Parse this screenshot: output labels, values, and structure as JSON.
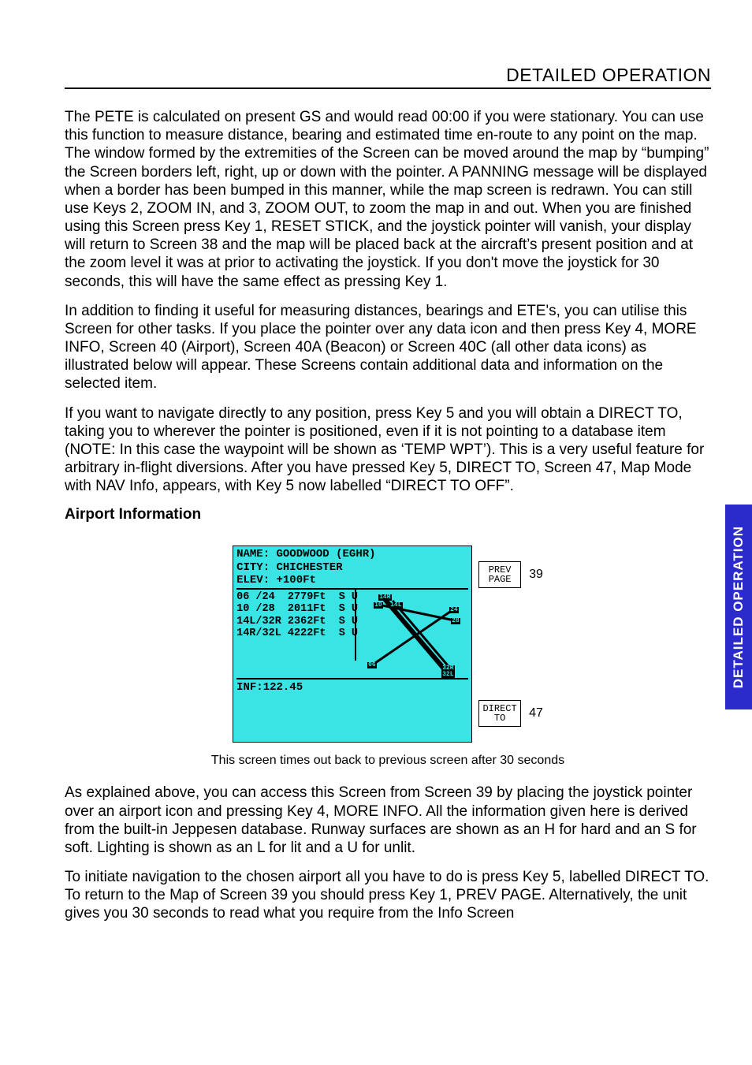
{
  "header": {
    "title": "DETAILED OPERATION"
  },
  "sidebar": {
    "label": "DETAILED OPERATION"
  },
  "paragraphs": {
    "p1": "The PETE is calculated on present GS and would read 00:00 if you were stationary.  You can use this function to measure distance, bearing and estimated time en-route to any point on the map.  The window formed by the extremities of the Screen can be moved around the map by “bumping” the Screen borders left, right, up or down with the pointer.  A PANNING message will be displayed when a border has been bumped in this manner, while the map screen is redrawn.  You can still use Keys 2, ZOOM IN, and 3, ZOOM OUT, to zoom the map in and out.  When you are finished using this Screen press Key 1, RESET STICK, and the joystick pointer will vanish, your display will return to Screen 38 and the map will be placed back at the aircraft’s present position and at the zoom level it was at prior to activating the joystick.  If you don't move the joystick for 30 seconds, this will have the same effect as pressing Key 1.",
    "p2": "In addition to finding it useful for measuring distances, bearings and ETE's, you can utilise this Screen for other tasks.  If you place the pointer over any data icon and then press Key 4, MORE INFO, Screen 40 (Airport), Screen 40A (Beacon) or Screen 40C (all other data icons) as illustrated below will appear. These Screens contain additional data and information on the selected item.",
    "p3": "If you want to navigate directly to any position, press Key 5 and you will obtain a DIRECT TO, taking you to wherever the pointer is positioned, even if it is not pointing to a database item (NOTE: In this case the waypoint will be shown as ‘TEMP WPT’).  This is a very useful feature for arbitrary in-flight diversions. After you have pressed Key 5, DIRECT TO, Screen 47, Map Mode with NAV Info, appears, with Key 5 now labelled “DIRECT TO OFF”.",
    "p4": "As explained above, you can access this Screen from Screen 39 by placing the joystick pointer over an airport icon and pressing Key 4, MORE INFO.  All the information given here is derived from the built-in Jeppesen database.  Runway surfaces are shown as an H for hard and an S for soft.  Lighting is shown as an L for lit and a U for unlit.",
    "p5": "To initiate navigation to the chosen airport all you have to do is press Key 5, labelled DIRECT TO.  To return to the Map of Screen 39 you should press Key 1, PREV PAGE.  Alternatively, the unit gives you 30 seconds to read what you require from the Info Screen"
  },
  "section": {
    "airport_info": "Airport Information"
  },
  "screen": {
    "name_line": "NAME: GOODWOOD (EGHR)",
    "city_line": "CITY: CHICHESTER",
    "elev_line": "ELEV: +100Ft",
    "runways_block": "06 /24  2779Ft  S U\n10 /28  2011Ft  S U\n14L/32R 2362Ft  S U\n14R/32L 4222Ft  S U",
    "inf_line": "INF:122.45",
    "diagram_labels": {
      "l1": "14R",
      "l2": "10",
      "l3": "14L",
      "l4": "24",
      "l5": "28",
      "l6": "06",
      "l7": "32R",
      "l8": "32L"
    }
  },
  "softkeys": {
    "top": {
      "label": "PREV\nPAGE",
      "num": "39"
    },
    "bottom": {
      "label": "DIRECT\nTO",
      "num": "47"
    }
  },
  "caption": "This screen times out back to previous screen after 30 seconds"
}
